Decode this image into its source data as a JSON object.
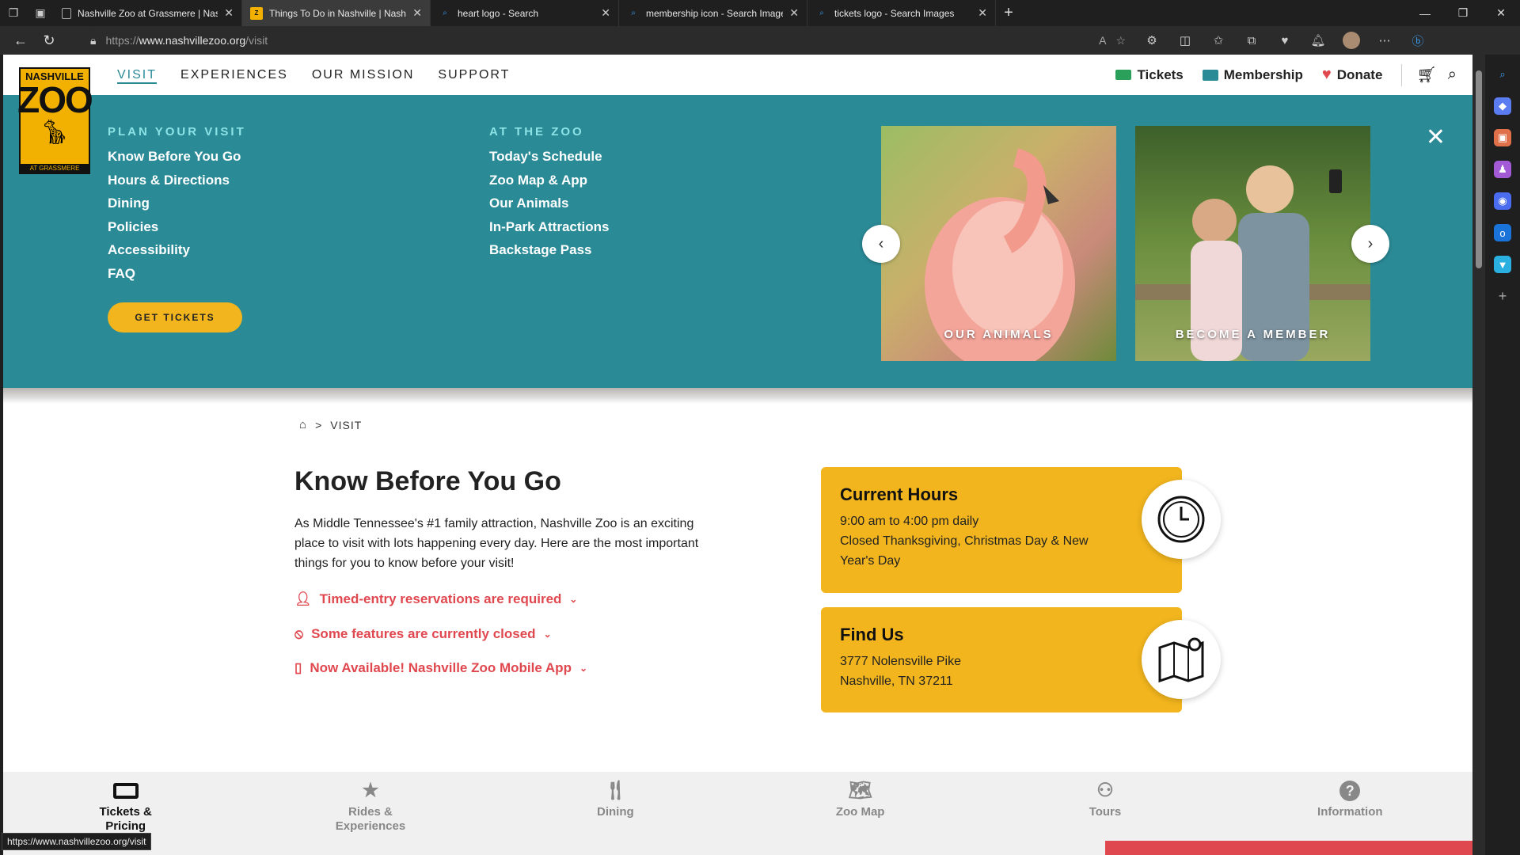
{
  "browser": {
    "tabs": [
      {
        "title": "Nashville Zoo at Grassmere | Nas",
        "favicon": "page-icon",
        "active": false
      },
      {
        "title": "Things To Do in Nashville | Nash",
        "favicon": "zoo-favicon",
        "active": true
      },
      {
        "title": "heart logo - Search",
        "favicon": "search-icon",
        "active": false
      },
      {
        "title": "membership icon - Search Image",
        "favicon": "search-icon",
        "active": false
      },
      {
        "title": "tickets logo - Search Images",
        "favicon": "search-icon",
        "active": false
      }
    ],
    "url_prefix": "https://",
    "url_host": "www.nashvillezoo.org",
    "url_path": "/visit",
    "status_url": "https://www.nashvillezoo.org/visit"
  },
  "logo": {
    "top": "NASHVILLE",
    "main": "ZOO",
    "bottom": "AT GRASSMERE"
  },
  "nav": {
    "items": [
      "VISIT",
      "EXPERIENCES",
      "OUR MISSION",
      "SUPPORT"
    ],
    "active": "VISIT",
    "tickets": "Tickets",
    "membership": "Membership",
    "donate": "Donate"
  },
  "mega": {
    "plan_head": "PLAN YOUR VISIT",
    "plan_links": [
      "Know Before You Go",
      "Hours & Directions",
      "Dining",
      "Policies",
      "Accessibility",
      "FAQ"
    ],
    "zoo_head": "AT THE ZOO",
    "zoo_links": [
      "Today's Schedule",
      "Zoo Map & App",
      "Our Animals",
      "In-Park Attractions",
      "Backstage Pass"
    ],
    "cta": "GET TICKETS",
    "cards": [
      "OUR ANIMALS",
      "BECOME A MEMBER"
    ]
  },
  "breadcrumb": {
    "sep": ">",
    "current": "VISIT"
  },
  "content": {
    "title": "Know Before You Go",
    "intro": "As Middle Tennessee's #1 family attraction, Nashville Zoo is an exciting place to visit with lots happening every day. Here are the most important things for you to know before your visit!",
    "accordions": [
      "Timed-entry reservations are required",
      "Some features are currently closed",
      "Now Available! Nashville Zoo Mobile App"
    ]
  },
  "hours": {
    "title": "Current Hours",
    "line1": "9:00 am to 4:00 pm daily",
    "line2": "Closed Thanksgiving, Christmas Day & New Year's Day"
  },
  "find": {
    "title": "Find Us",
    "line1": "3777 Nolensville Pike",
    "line2": "Nashville, TN 37211"
  },
  "bottombar": [
    {
      "label": "Tickets & Pricing",
      "icon": "ticket-icon",
      "active": true
    },
    {
      "label": "Rides & Experiences",
      "icon": "star-icon",
      "active": false
    },
    {
      "label": "Dining",
      "icon": "fork-knife-icon",
      "active": false
    },
    {
      "label": "Zoo Map",
      "icon": "map-icon",
      "active": false
    },
    {
      "label": "Tours",
      "icon": "binoculars-icon",
      "active": false
    },
    {
      "label": "Information",
      "icon": "question-icon",
      "active": false
    }
  ],
  "colors": {
    "teal": "#2a8a96",
    "gold": "#f2b51d",
    "red": "#e0484f"
  }
}
